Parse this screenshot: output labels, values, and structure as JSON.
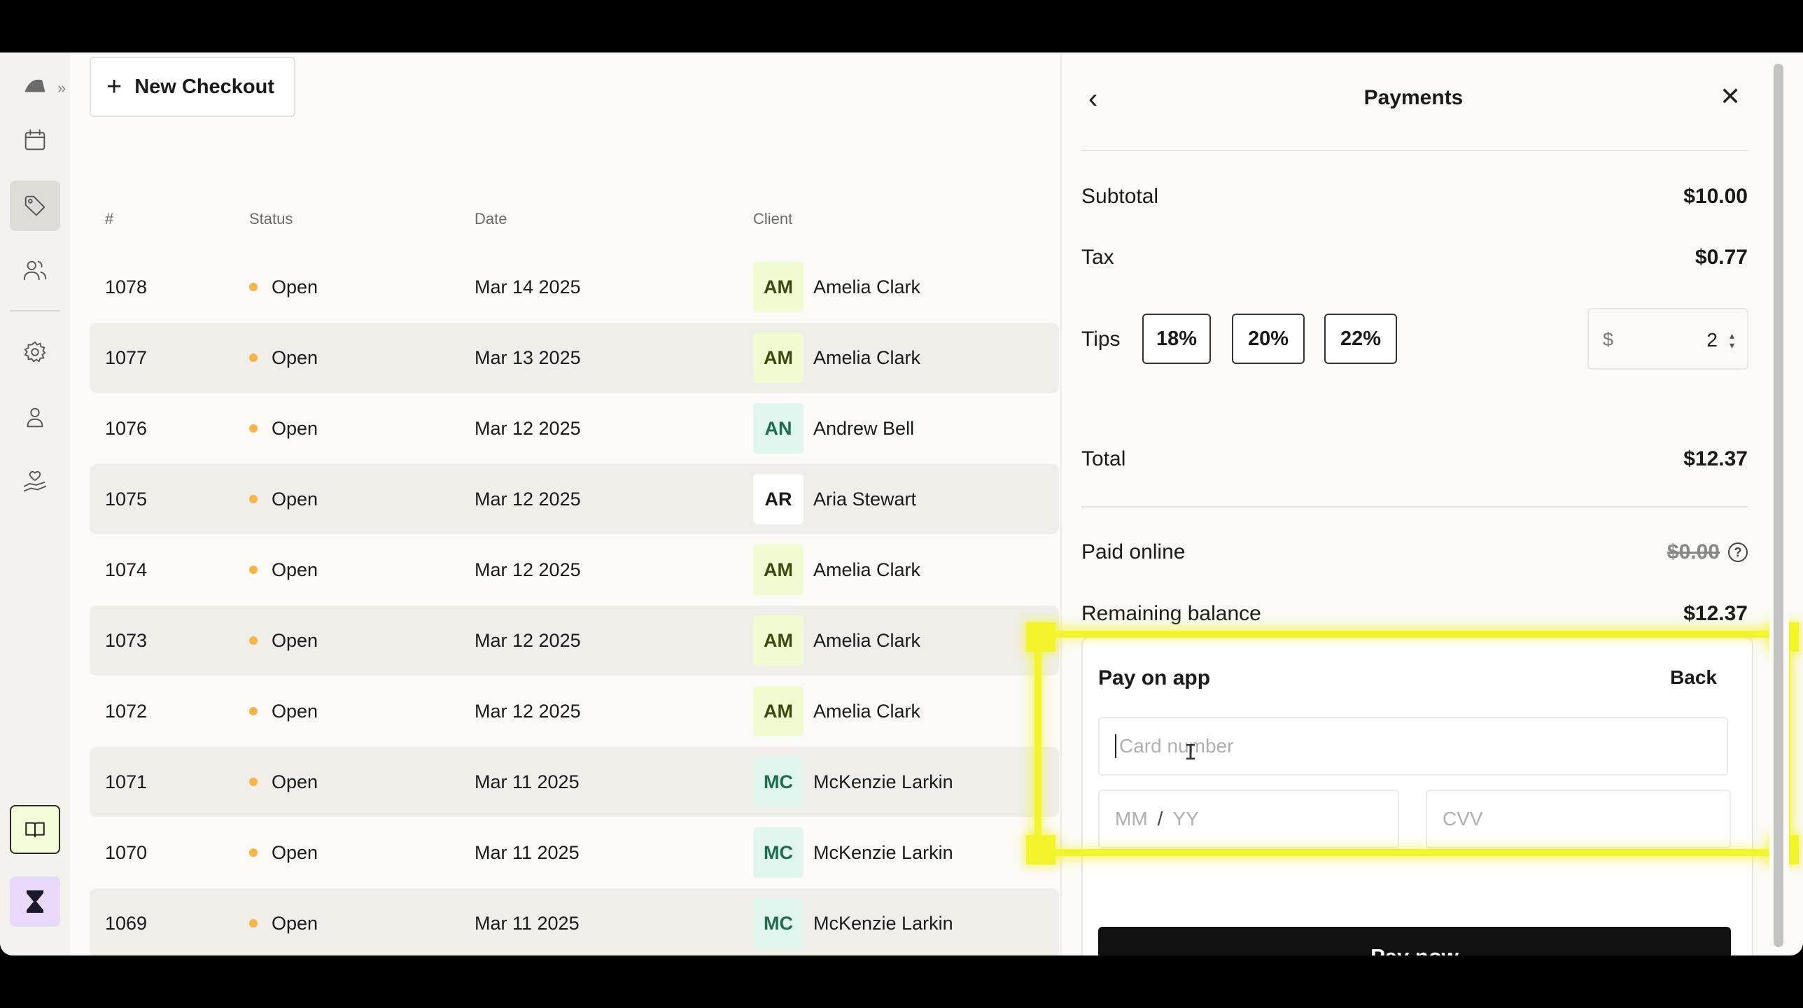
{
  "toolbar": {
    "new_checkout_label": "New Checkout"
  },
  "table": {
    "headers": {
      "num": "#",
      "status": "Status",
      "date": "Date",
      "client": "Client"
    },
    "rows": [
      {
        "num": "1078",
        "status": "Open",
        "date": "Mar 14 2025",
        "initials": "AM",
        "client": "Amelia Clark"
      },
      {
        "num": "1077",
        "status": "Open",
        "date": "Mar 13 2025",
        "initials": "AM",
        "client": "Amelia Clark"
      },
      {
        "num": "1076",
        "status": "Open",
        "date": "Mar 12 2025",
        "initials": "AN",
        "client": "Andrew Bell"
      },
      {
        "num": "1075",
        "status": "Open",
        "date": "Mar 12 2025",
        "initials": "AR",
        "client": "Aria Stewart"
      },
      {
        "num": "1074",
        "status": "Open",
        "date": "Mar 12 2025",
        "initials": "AM",
        "client": "Amelia Clark"
      },
      {
        "num": "1073",
        "status": "Open",
        "date": "Mar 12 2025",
        "initials": "AM",
        "client": "Amelia Clark"
      },
      {
        "num": "1072",
        "status": "Open",
        "date": "Mar 12 2025",
        "initials": "AM",
        "client": "Amelia Clark"
      },
      {
        "num": "1071",
        "status": "Open",
        "date": "Mar 11 2025",
        "initials": "MC",
        "client": "McKenzie Larkin"
      },
      {
        "num": "1070",
        "status": "Open",
        "date": "Mar 11 2025",
        "initials": "MC",
        "client": "McKenzie Larkin"
      },
      {
        "num": "1069",
        "status": "Open",
        "date": "Mar 11 2025",
        "initials": "MC",
        "client": "McKenzie Larkin"
      }
    ]
  },
  "payments": {
    "title": "Payments",
    "subtotal_label": "Subtotal",
    "subtotal_value": "$10.00",
    "tax_label": "Tax",
    "tax_value": "$0.77",
    "tips_label": "Tips",
    "tip_options": [
      "18%",
      "20%",
      "22%"
    ],
    "tip_currency": "$",
    "tip_amount": "2",
    "total_label": "Total",
    "total_value": "$12.37",
    "paid_online_label": "Paid online",
    "paid_online_value": "$0.00",
    "remaining_label": "Remaining balance",
    "remaining_value": "$12.37",
    "pay_card": {
      "title": "Pay on app",
      "back_label": "Back",
      "card_placeholder": "Card number",
      "mm": "MM",
      "slash": "/",
      "yy": "YY",
      "cvv": "CVV",
      "pay_now_label": "Pay now"
    }
  },
  "colors": {
    "status_open": "#f5b547",
    "highlight": "#f2f52c",
    "avatar_am": "#f1fbd2",
    "avatar_an": "#e0f5ee",
    "avatar_ar": "#ffffff",
    "avatar_mc": "#e0f5ee"
  },
  "icons": {
    "sidebar": [
      "logo-icon",
      "calendar-icon",
      "tag-icon",
      "users-icon",
      "gear-icon",
      "person-icon",
      "hand-heart-icon",
      "book-icon",
      "hourglass-icon"
    ]
  }
}
